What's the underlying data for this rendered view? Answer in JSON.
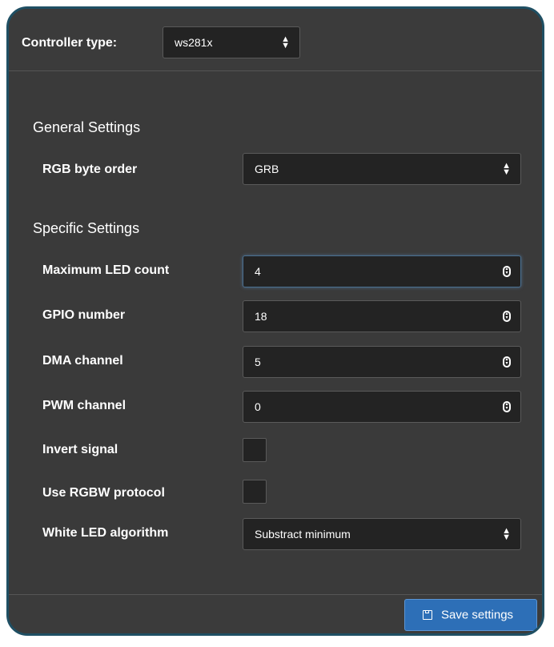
{
  "header": {
    "controller_label": "Controller type:",
    "controller_value": "ws281x"
  },
  "general": {
    "title": "General Settings",
    "rgb_byte_order_label": "RGB byte order",
    "rgb_byte_order_value": "GRB"
  },
  "specific": {
    "title": "Specific Settings",
    "max_led_count_label": "Maximum LED count",
    "max_led_count_value": "4",
    "gpio_label": "GPIO number",
    "gpio_value": "18",
    "dma_label": "DMA channel",
    "dma_value": "5",
    "pwm_label": "PWM channel",
    "pwm_value": "0",
    "invert_label": "Invert signal",
    "rgbw_label": "Use RGBW protocol",
    "white_algo_label": "White LED algorithm",
    "white_algo_value": "Substract minimum"
  },
  "footer": {
    "save_label": "Save settings"
  },
  "colors": {
    "panel_bg": "#3a3a3a",
    "panel_border": "#1f4f63",
    "input_bg": "#232323",
    "button_bg": "#2d6fb7"
  }
}
